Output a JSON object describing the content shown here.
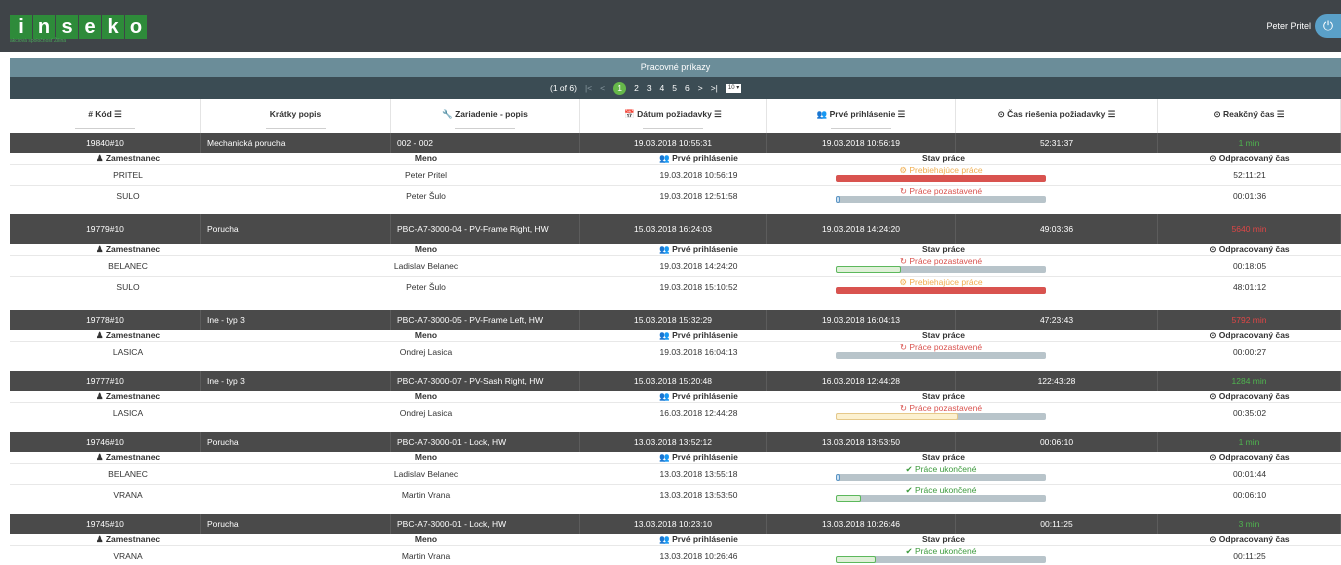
{
  "app": {
    "logo_letters": [
      "i",
      "n",
      "s",
      "e",
      "k",
      "o"
    ],
    "logo_tagline": "akciová spoločnosť Žilina",
    "user_name": "Peter Pritel",
    "power_icon": "⏻"
  },
  "panel": {
    "title": "Pracovné príkazy"
  },
  "pager": {
    "page_info": "(1 of 6)",
    "first": "|<",
    "prev": "<",
    "pages": [
      "1",
      "2",
      "3",
      "4",
      "5",
      "6"
    ],
    "next": ">",
    "last": ">|",
    "page_size": "10 ▾"
  },
  "columns": [
    {
      "label": "# Kód ☰"
    },
    {
      "label": "Krátky popis"
    },
    {
      "label": "🔧 Zariadenie - popis"
    },
    {
      "label": "📅 Dátum požiadavky ☰"
    },
    {
      "label": "👥 Prvé prihlásenie ☰"
    },
    {
      "label": "⊙ Čas riešenia požiadavky ☰"
    },
    {
      "label": "⊙ Reakčný čas ☰"
    }
  ],
  "sub_columns": {
    "employee": "♟ Zamestnanec",
    "name": "Meno",
    "first_login": "👥 Prvé prihlásenie",
    "status": "Stav práce",
    "worked": "⊙ Odpracovaný čas"
  },
  "orders": [
    {
      "code": "19840#10",
      "short": "Mechanická porucha",
      "device": "002 - 002",
      "date": "19.03.2018 10:55:31",
      "first": "19.03.2018 10:56:19",
      "solve": "52:31:37",
      "react": "1 min",
      "react_color": "green",
      "rows": [
        {
          "emp": "PRITEL",
          "name": "Peter Pritel",
          "login": "19.03.2018 10:56:19",
          "status": "⚙ Prebiehajúce práce",
          "status_color": "orange",
          "progress": 1.0,
          "fill_color": "red",
          "worked": "52:11:21"
        },
        {
          "emp": "SULO",
          "name": "Peter Šulo",
          "login": "19.03.2018 12:51:58",
          "status": "↻ Práce pozastavené",
          "status_color": "red",
          "progress": 0.02,
          "fill_color": "blue",
          "worked": "00:01:36"
        }
      ]
    },
    {
      "code": "19779#10",
      "short": "Porucha",
      "device": "PBC-A7-3000-04 - PV-Frame Right, HW",
      "date": "15.03.2018 16:24:03",
      "first": "19.03.2018 14:24:20",
      "solve": "49:03:36",
      "react": "5640 min",
      "react_color": "red",
      "rows": [
        {
          "emp": "BELANEC",
          "name": "Ladislav Belanec",
          "login": "19.03.2018 14:24:20",
          "status": "↻ Práce pozastavené",
          "status_color": "red",
          "progress": 0.31,
          "fill_color": "lightgreen",
          "worked": "00:18:05"
        },
        {
          "emp": "SULO",
          "name": "Peter Šulo",
          "login": "19.03.2018 15:10:52",
          "status": "⚙ Prebiehajúce práce",
          "status_color": "orange",
          "progress": 1.0,
          "fill_color": "red",
          "worked": "48:01:12"
        }
      ]
    },
    {
      "code": "19778#10",
      "short": "Ine - typ 3",
      "device": "PBC-A7-3000-05 - PV-Frame Left, HW",
      "date": "15.03.2018 15:32:29",
      "first": "19.03.2018 16:04:13",
      "solve": "47:23:43",
      "react": "5792 min",
      "react_color": "red",
      "rows": [
        {
          "emp": "LASICA",
          "name": "Ondrej Lasica",
          "login": "19.03.2018 16:04:13",
          "status": "↻ Práce pozastavené",
          "status_color": "red",
          "progress": 0.0,
          "fill_color": "none",
          "worked": "00:00:27"
        }
      ]
    },
    {
      "code": "19777#10",
      "short": "Ine - typ 3",
      "device": "PBC-A7-3000-07 - PV-Sash Right, HW",
      "date": "15.03.2018 15:20:48",
      "first": "16.03.2018 12:44:28",
      "solve": "122:43:28",
      "react": "1284 min",
      "react_color": "green",
      "rows": [
        {
          "emp": "LASICA",
          "name": "Ondrej Lasica",
          "login": "16.03.2018 12:44:28",
          "status": "↻ Práce pozastavené",
          "status_color": "red",
          "progress": 0.58,
          "fill_color": "cream",
          "worked": "00:35:02"
        }
      ]
    },
    {
      "code": "19746#10",
      "short": "Porucha",
      "device": "PBC-A7-3000-01 - Lock, HW",
      "date": "13.03.2018 13:52:12",
      "first": "13.03.2018 13:53:50",
      "solve": "00:06:10",
      "react": "1 min",
      "react_color": "green",
      "rows": [
        {
          "emp": "BELANEC",
          "name": "Ladislav Belanec",
          "login": "13.03.2018 13:55:18",
          "status": "✔ Práce ukončené",
          "status_color": "green",
          "progress": 0.02,
          "fill_color": "blue",
          "worked": "00:01:44"
        },
        {
          "emp": "VRANA",
          "name": "Martin Vrana",
          "login": "13.03.2018 13:53:50",
          "status": "✔ Práce ukončené",
          "status_color": "green",
          "progress": 0.12,
          "fill_color": "lightgreen",
          "worked": "00:06:10"
        }
      ]
    },
    {
      "code": "19745#10",
      "short": "Porucha",
      "device": "PBC-A7-3000-01 - Lock, HW",
      "date": "13.03.2018 10:23:10",
      "first": "13.03.2018 10:26:46",
      "solve": "00:11:25",
      "react": "3 min",
      "react_color": "green",
      "rows": [
        {
          "emp": "VRANA",
          "name": "Martin Vrana",
          "login": "13.03.2018 10:26:46",
          "status": "✔ Práce ukončené",
          "status_color": "green",
          "progress": 0.19,
          "fill_color": "lightgreen",
          "worked": "00:11:25"
        }
      ]
    }
  ]
}
